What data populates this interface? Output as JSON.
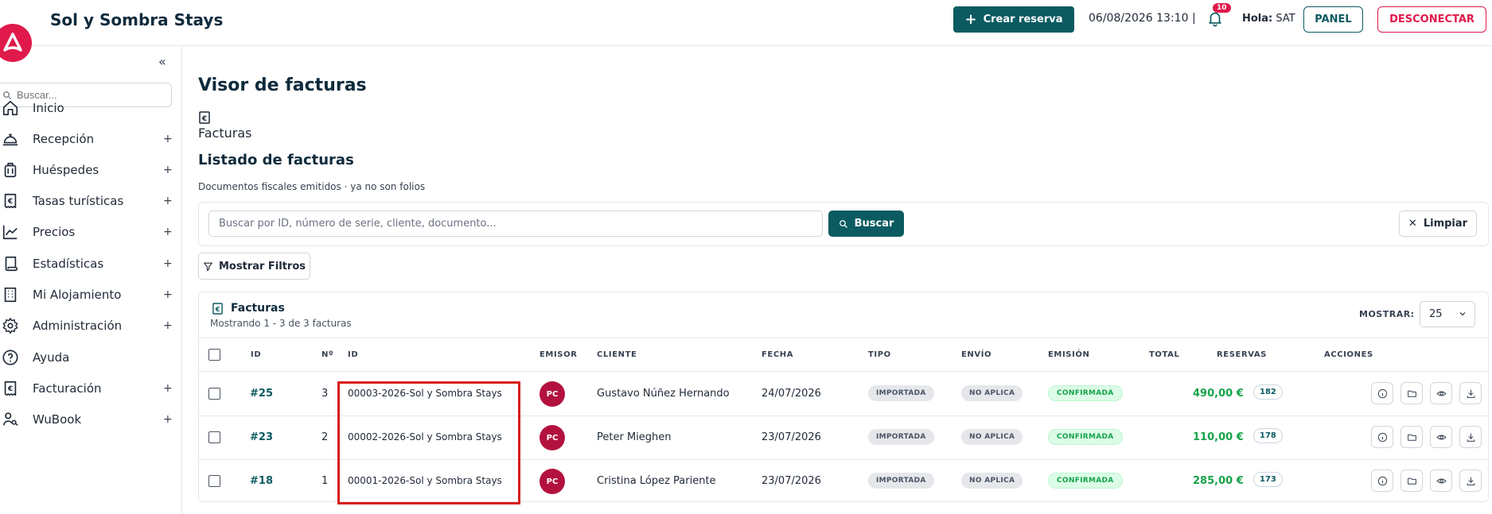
{
  "header": {
    "app_title": "Sol y Sombra Stays",
    "create_button": "Crear reserva",
    "datetime": "06/08/2026 13:10 |",
    "notifications_count": "10",
    "greeting_label": "Hola:",
    "user": "SAT",
    "panel_button": "PANEL",
    "logout_button": "DESCONECTAR"
  },
  "sidebar": {
    "search_placeholder": "Buscar...",
    "items": [
      {
        "label": "Inicio",
        "icon": "home-icon",
        "expandable": false
      },
      {
        "label": "Recepción",
        "icon": "bell-desk-icon",
        "expandable": true
      },
      {
        "label": "Huéspedes",
        "icon": "luggage-icon",
        "expandable": true
      },
      {
        "label": "Tasas turísticas",
        "icon": "euro-receipt-icon",
        "expandable": true
      },
      {
        "label": "Precios",
        "icon": "chart-line-icon",
        "expandable": true
      },
      {
        "label": "Estadísticas",
        "icon": "scroll-icon",
        "expandable": true
      },
      {
        "label": "Mi Alojamiento",
        "icon": "building-icon",
        "expandable": true
      },
      {
        "label": "Administración",
        "icon": "gear-icon",
        "expandable": true
      },
      {
        "label": "Ayuda",
        "icon": "help-icon",
        "expandable": false
      },
      {
        "label": "Facturación",
        "icon": "euro-receipt-icon",
        "expandable": true
      },
      {
        "label": "WuBook",
        "icon": "users-key-icon",
        "expandable": true
      }
    ],
    "plus": "+"
  },
  "main": {
    "title": "Visor de facturas",
    "breadcrumb": "Facturas",
    "list_title": "Listado de facturas",
    "list_subtitle": "Documentos fiscales emitidos · ya no son folios",
    "search_placeholder": "Buscar por ID, número de serie, cliente, documento...",
    "search_button": "Buscar",
    "clear_button": "Limpiar",
    "filters_button": "Mostrar Filtros"
  },
  "table": {
    "title": "Facturas",
    "subtitle": "Mostrando 1 - 3 de 3 facturas",
    "show_label": "MOSTRAR:",
    "show_value": "25",
    "headers": {
      "id": "ID",
      "num": "Nº",
      "serie": "ID",
      "emisor": "EMISOR",
      "cliente": "CLIENTE",
      "fecha": "FECHA",
      "tipo": "TIPO",
      "envio": "ENVÍO",
      "emision": "EMISIÓN",
      "total": "TOTAL",
      "reservas": "RESERVAS",
      "acciones": "ACCIONES"
    },
    "rows": [
      {
        "id": "#25",
        "num": "3",
        "serie": "00003-2026-Sol y Sombra Stays",
        "emisor": "PC",
        "cliente": "Gustavo Núñez Hernando",
        "fecha": "24/07/2026",
        "tipo": "IMPORTADA",
        "envio": "NO APLICA",
        "emision": "CONFIRMADA",
        "total": "490,00 €",
        "reservas": "182"
      },
      {
        "id": "#23",
        "num": "2",
        "serie": "00002-2026-Sol y Sombra Stays",
        "emisor": "PC",
        "cliente": "Peter Mieghen",
        "fecha": "23/07/2026",
        "tipo": "IMPORTADA",
        "envio": "NO APLICA",
        "emision": "CONFIRMADA",
        "total": "110,00 €",
        "reservas": "178"
      },
      {
        "id": "#18",
        "num": "1",
        "serie": "00001-2026-Sol y Sombra Stays",
        "emisor": "PC",
        "cliente": "Cristina López Pariente",
        "fecha": "23/07/2026",
        "tipo": "IMPORTADA",
        "envio": "NO APLICA",
        "emision": "CONFIRMADA",
        "total": "285,00 €",
        "reservas": "173"
      }
    ]
  },
  "colors": {
    "brand": "#e0194b",
    "primary": "#0b5b61",
    "success": "#16a34a",
    "highlight": "#d91c1c"
  }
}
